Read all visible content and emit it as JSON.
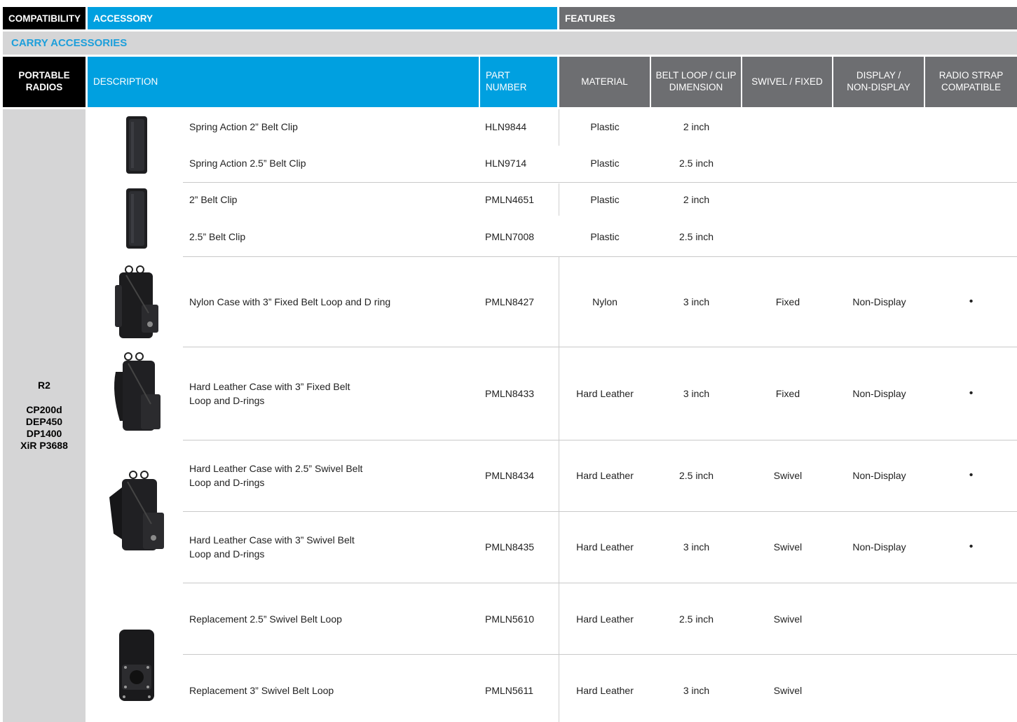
{
  "header": {
    "compatibility": "COMPATIBILITY",
    "accessory": "ACCESSORY",
    "features": "FEATURES"
  },
  "section_title": "CARRY ACCESSORIES",
  "columns": {
    "radios": "PORTABLE RADIOS",
    "description": "DESCRIPTION",
    "part_number": "PART NUMBER",
    "material": "MATERIAL",
    "clip_dimension": "BELT LOOP / CLIP DIMENSION",
    "swivel_fixed": "SWIVEL / FIXED",
    "display": "DISPLAY / NON-DISPLAY",
    "strap": "RADIO STRAP COMPATIBLE"
  },
  "compatibility": {
    "series": "R2",
    "models": [
      "CP200d",
      "DEP450",
      "DP1400",
      "XiR P3688"
    ]
  },
  "rows": [
    {
      "description": "Spring Action 2” Belt Clip",
      "part": "HLN9844",
      "material": "Plastic",
      "clip": "2 inch",
      "swivel": "",
      "display": "",
      "strap": ""
    },
    {
      "description": "Spring Action 2.5” Belt Clip",
      "part": "HLN9714",
      "material": "Plastic",
      "clip": "2.5 inch",
      "swivel": "",
      "display": "",
      "strap": ""
    },
    {
      "description": "2” Belt Clip",
      "part": "PMLN4651",
      "material": "Plastic",
      "clip": "2 inch",
      "swivel": "",
      "display": "",
      "strap": ""
    },
    {
      "description": "2.5” Belt Clip",
      "part": "PMLN7008",
      "material": "Plastic",
      "clip": "2.5 inch",
      "swivel": "",
      "display": "",
      "strap": ""
    },
    {
      "description": "Nylon Case with 3” Fixed Belt Loop and D ring",
      "part": "PMLN8427",
      "material": "Nylon",
      "clip": "3 inch",
      "swivel": "Fixed",
      "display": "Non-Display",
      "strap": "•"
    },
    {
      "description": "Hard Leather Case with 3” Fixed Belt Loop and D-rings",
      "part": "PMLN8433",
      "material": "Hard Leather",
      "clip": "3 inch",
      "swivel": "Fixed",
      "display": "Non-Display",
      "strap": "•"
    },
    {
      "description": "Hard Leather Case with 2.5” Swivel Belt Loop and D-rings",
      "part": "PMLN8434",
      "material": "Hard Leather",
      "clip": "2.5 inch",
      "swivel": "Swivel",
      "display": "Non-Display",
      "strap": "•"
    },
    {
      "description": "Hard Leather Case with 3” Swivel Belt Loop and D-rings",
      "part": "PMLN8435",
      "material": "Hard Leather",
      "clip": "3 inch",
      "swivel": "Swivel",
      "display": "Non-Display",
      "strap": "•"
    },
    {
      "description": "Replacement 2.5” Swivel Belt Loop",
      "part": "PMLN5610",
      "material": "Hard Leather",
      "clip": "2.5 inch",
      "swivel": "Swivel",
      "display": "",
      "strap": ""
    },
    {
      "description": "Replacement 3” Swivel Belt Loop",
      "part": "PMLN5611",
      "material": "Hard Leather",
      "clip": "3 inch",
      "swivel": "Swivel",
      "display": "",
      "strap": ""
    }
  ],
  "images": [
    {
      "icon": "belt-clip-image"
    },
    {
      "icon": "belt-clip-image"
    },
    {
      "icon": "nylon-case-image"
    },
    {
      "icon": "leather-case-image"
    },
    {
      "icon": "leather-case-swivel-image"
    },
    {
      "icon": "swivel-belt-loop-image"
    }
  ]
}
